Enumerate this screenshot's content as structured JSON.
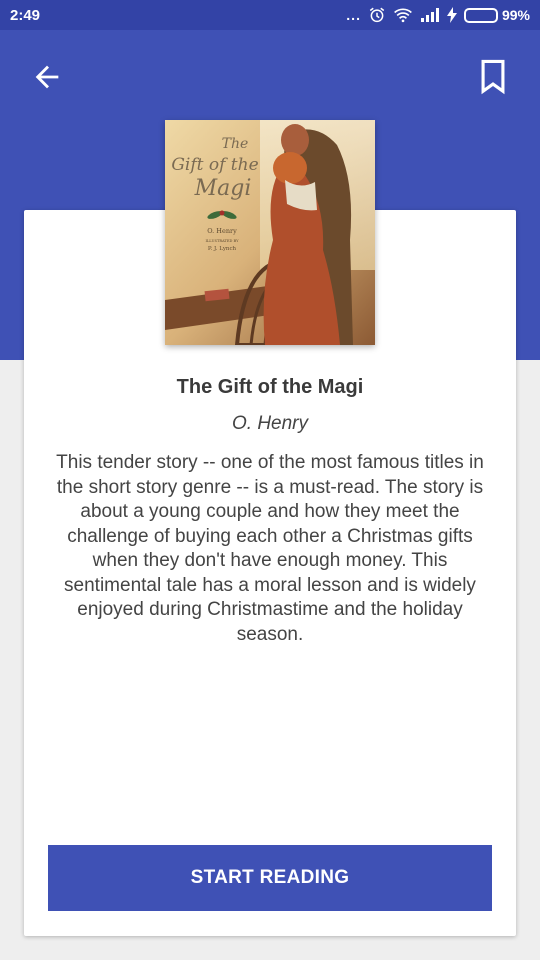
{
  "status_bar": {
    "time": "2:49",
    "more_dots": "...",
    "battery_percent": "99%",
    "battery_level": 0.99
  },
  "app_bar": {
    "back_icon": "arrow-left-icon",
    "bookmark_icon": "bookmark-icon"
  },
  "book": {
    "cover": {
      "title_line1": "The",
      "title_line2": "Gift of the",
      "title_line3": "Magi",
      "author": "O. Henry",
      "illustrated_by": "ILLUSTRATED BY",
      "illustrator": "P. J. Lynch"
    },
    "title": "The Gift of the Magi",
    "author": "O. Henry",
    "description": "This tender story -- one of the most famous titles in the short story genre -- is a must-read. The story is about a young couple and how they meet the challenge of buying each other a Christmas gifts when they don't have enough money. This sentimental tale has a moral lesson and is widely enjoyed during Christmastime and the holiday season."
  },
  "actions": {
    "start_reading_label": "START READING"
  },
  "colors": {
    "primary": "#3f51b5",
    "status_bar": "#3343a6",
    "background": "#eeeeee"
  }
}
